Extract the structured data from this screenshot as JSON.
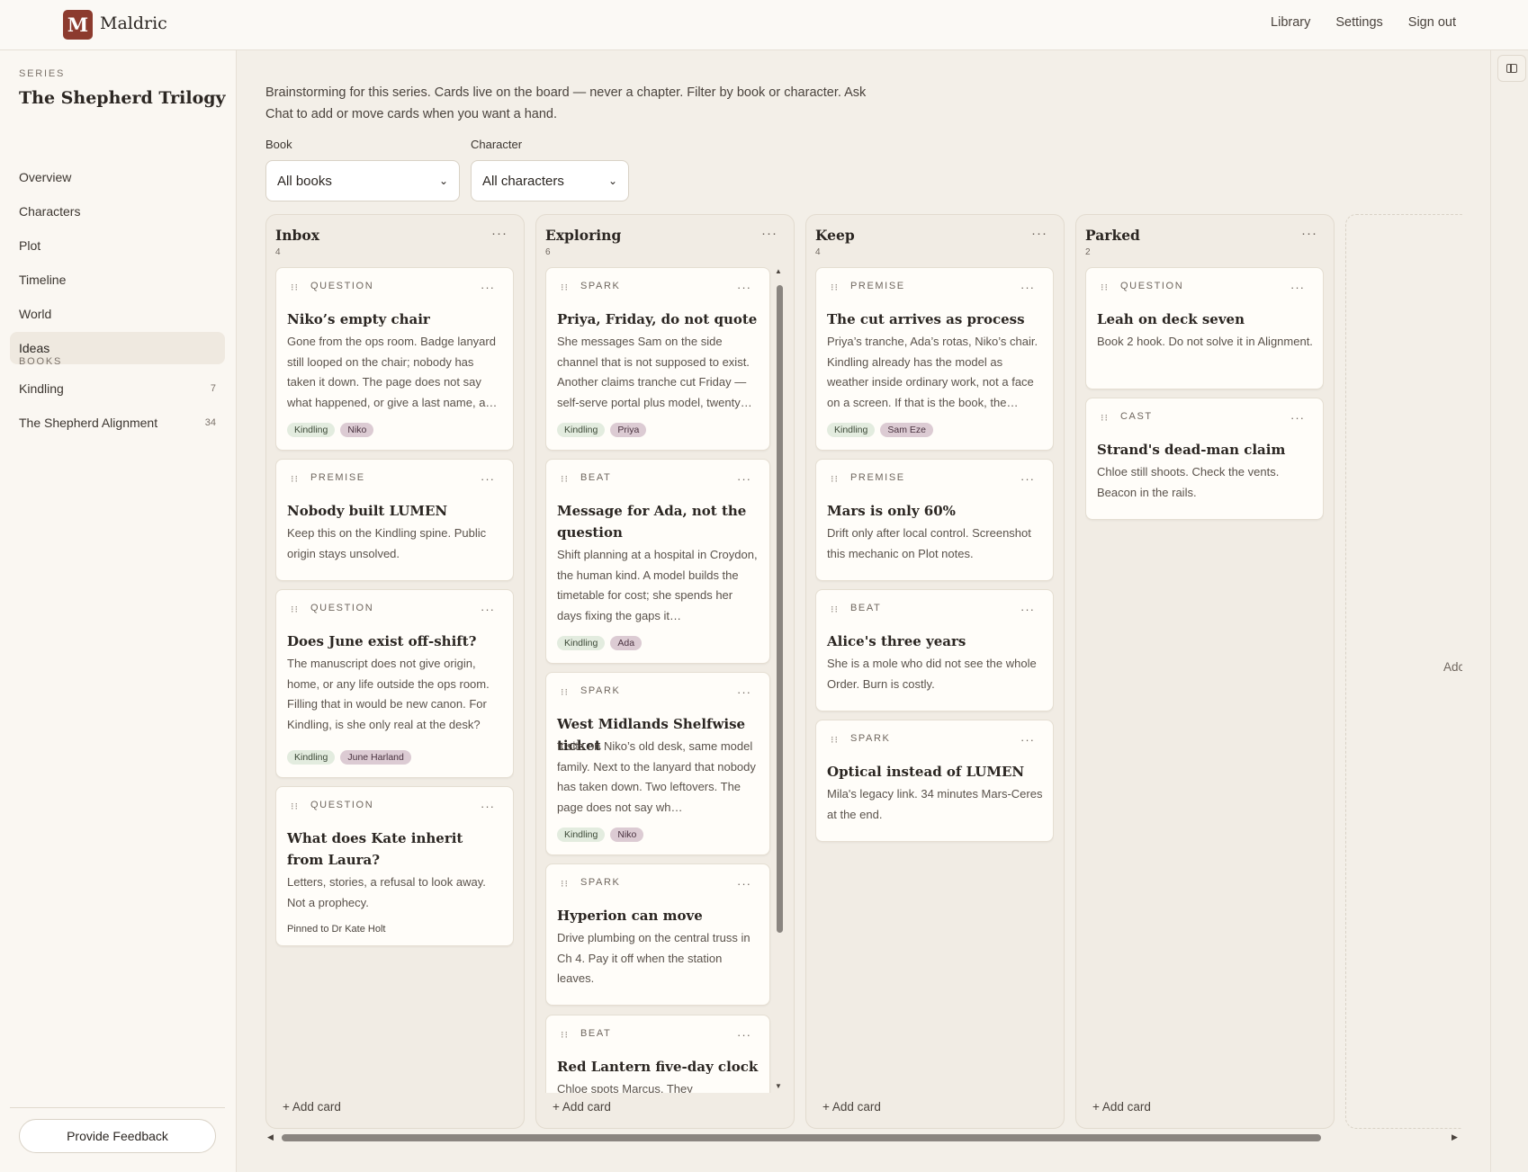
{
  "app": {
    "logo_letter": "M",
    "brand": "Maldric"
  },
  "topnav": {
    "library": "Library",
    "settings": "Settings",
    "sign_out": "Sign out"
  },
  "sidebar": {
    "series_label": "SERIES",
    "series_title": "The Shepherd Trilogy",
    "nav": [
      "Overview",
      "Characters",
      "Plot",
      "Timeline",
      "World",
      "Ideas"
    ],
    "active": "Ideas",
    "books_label": "BOOKS",
    "books": [
      {
        "name": "Kindling",
        "count": "7"
      },
      {
        "name": "The Shepherd Alignment",
        "count": "34"
      }
    ],
    "feedback": "Provide Feedback"
  },
  "intro": "Brainstorming for this series. Cards live on the board — never a chapter. Filter by book or character. Ask Chat to add or move cards when you want a hand.",
  "filters": {
    "book_label": "Book",
    "book_value": "All books",
    "character_label": "Character",
    "character_value": "All characters"
  },
  "board": {
    "add_card": "+ Add card",
    "add_column_partial": "Adc",
    "columns": [
      {
        "title": "Inbox",
        "count": "4",
        "cards": [
          {
            "type": "QUESTION",
            "title": "Niko’s empty chair",
            "body": "Gone from the ops room. Badge lanyard still looped on the chair; nobody has taken it down. The page does not say what happened, or give a last name, a…",
            "tags": [
              "Kindling",
              "Niko"
            ]
          },
          {
            "type": "PREMISE",
            "title": "Nobody built LUMEN",
            "body": "Keep this on the Kindling spine. Public origin stays unsolved.",
            "tags": []
          },
          {
            "type": "QUESTION",
            "title": "Does June exist off-shift?",
            "body": "The manuscript does not give origin, home, or any life outside the ops room. Filling that in would be new canon. For Kindling, is she only real at the desk?",
            "tags": [
              "Kindling",
              "June Harland"
            ]
          },
          {
            "type": "QUESTION",
            "title": "What does Kate inherit from Laura?",
            "body": "Letters, stories, a refusal to look away. Not a prophecy.",
            "tags": [],
            "pinned": "Pinned to Dr Kate Holt"
          }
        ]
      },
      {
        "title": "Exploring",
        "count": "6",
        "cards": [
          {
            "type": "SPARK",
            "title": "Priya, Friday, do not quote",
            "body": "She messages Sam on the side channel that is not supposed to exist. Another claims tranche cut Friday — self-serve portal plus model, twenty…",
            "tags": [
              "Kindling",
              "Priya"
            ]
          },
          {
            "type": "BEAT",
            "title": "Message for Ada, not the question",
            "body": "Shift planning at a hospital in Croydon, the human kind. A model builds the timetable for cost; she spends her days fixing the gaps it…",
            "tags": [
              "Kindling",
              "Ada"
            ]
          },
          {
            "type": "SPARK",
            "title": "West Midlands Shelfwise ticket",
            "body": "It sits on Niko’s old desk, same model family. Next to the lanyard that nobody has taken down. Two leftovers. The page does not say wh…",
            "tags": [
              "Kindling",
              "Niko"
            ]
          },
          {
            "type": "SPARK",
            "title": "Hyperion can move",
            "body": "Drive plumbing on the central truss in Ch 4. Pay it off when the station leaves.",
            "tags": []
          },
          {
            "type": "BEAT",
            "title": "Red Lantern five-day clock",
            "body": "Chloe spots Marcus. They reconvene…",
            "tags": []
          }
        ]
      },
      {
        "title": "Keep",
        "count": "4",
        "cards": [
          {
            "type": "PREMISE",
            "title": "The cut arrives as process",
            "body": "Priya’s tranche, Ada’s rotas, Niko’s chair. Kindling already has the model as weather inside ordinary work, not a face on a screen. If that is the book, the…",
            "tags": [
              "Kindling",
              "Sam Eze"
            ]
          },
          {
            "type": "PREMISE",
            "title": "Mars is only 60%",
            "body": "Drift only after local control. Screenshot this mechanic on Plot notes.",
            "tags": []
          },
          {
            "type": "BEAT",
            "title": "Alice's three years",
            "body": "She is a mole who did not see the whole Order. Burn is costly.",
            "tags": []
          },
          {
            "type": "SPARK",
            "title": "Optical instead of LUMEN",
            "body": "Mila's legacy link. 34 minutes Mars-Ceres at the end.",
            "tags": []
          }
        ]
      },
      {
        "title": "Parked",
        "count": "2",
        "cards": [
          {
            "type": "QUESTION",
            "title": "Leah on deck seven",
            "body": "Book 2 hook. Do not solve it in Alignment.",
            "tags": []
          },
          {
            "type": "CAST",
            "title": "Strand's dead-man claim",
            "body": "Chloe still shoots. Check the vents. Beacon in the rails.",
            "tags": []
          }
        ]
      }
    ]
  },
  "colors": {
    "brand": "#8c3b2e",
    "book_tag": "#e3ecdf",
    "character_tag": "#dccbd3"
  }
}
